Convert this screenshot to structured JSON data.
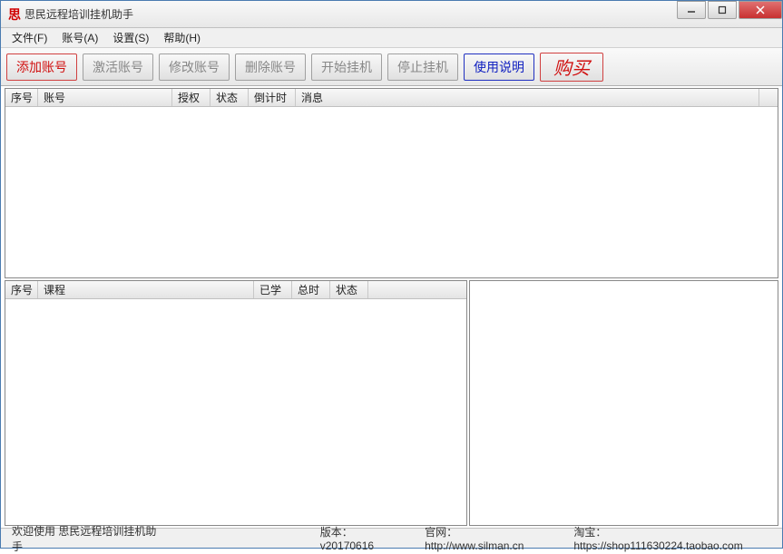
{
  "titlebar": {
    "icon_text": "思",
    "title": "思民远程培训挂机助手"
  },
  "menu": {
    "file": "文件(F)",
    "account": "账号(A)",
    "settings": "设置(S)",
    "help": "帮助(H)"
  },
  "toolbar": {
    "add": "添加账号",
    "activate": "激活账号",
    "modify": "修改账号",
    "delete": "删除账号",
    "start": "开始挂机",
    "stop": "停止挂机",
    "instructions": "使用说明",
    "buy": "购买"
  },
  "top_table": {
    "columns": {
      "seq": "序号",
      "account": "账号",
      "auth": "授权",
      "status": "状态",
      "countdown": "倒计时",
      "message": "消息"
    },
    "rows": []
  },
  "bottom_table": {
    "columns": {
      "seq": "序号",
      "course": "课程",
      "learned": "已学",
      "total": "总时",
      "status": "状态"
    },
    "rows": []
  },
  "statusbar": {
    "welcome": "欢迎使用 思民远程培训挂机助手",
    "version_label": "版本：",
    "version_value": "v20170616",
    "site_label": "官网：",
    "site_value": "http://www.silman.cn",
    "shop_label": "淘宝：",
    "shop_value": "https://shop111630224.taobao.com"
  }
}
